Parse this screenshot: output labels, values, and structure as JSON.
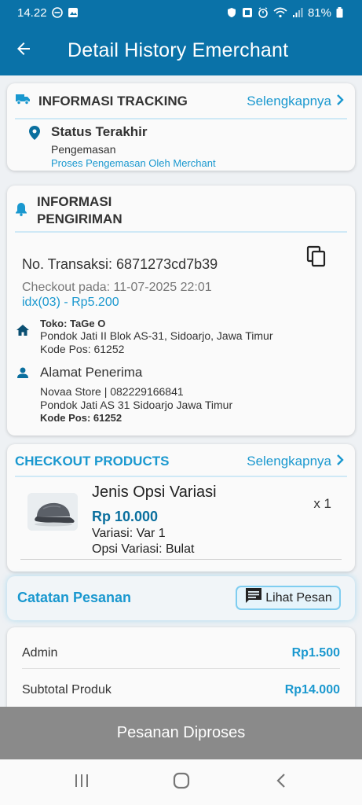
{
  "status_bar": {
    "time": "14.22",
    "battery": "81%"
  },
  "app_bar": {
    "title": "Detail History Emerchant"
  },
  "tracking": {
    "title": "INFORMASI TRACKING",
    "more_label": "Selengkapnya",
    "status_title": "Status Terakhir",
    "status_value": "Pengemasan",
    "status_desc": "Proses Pengemasan Oleh Merchant"
  },
  "shipping": {
    "title_line1": "INFORMASI",
    "title_line2": "PENGIRIMAN",
    "transaction_no": "No. Transaksi: 6871273cd7b39",
    "checkout_at": "Checkout pada: 11-07-2025 22:01",
    "idx_price": "idx(03) - Rp5.200",
    "store_name": "Toko: TaGe O",
    "store_address": "Pondok Jati II Blok AS-31, Sidoarjo, Jawa Timur",
    "store_postal": "Kode Pos: 61252",
    "receiver_title": "Alamat Penerima",
    "receiver_name_phone": "Novaa Store | 082229166841",
    "receiver_address": "Pondok Jati AS 31 Sidoarjo Jawa Timur",
    "receiver_postal": "Kode Pos: 61252"
  },
  "products": {
    "title": "CHECKOUT PRODUCTS",
    "more_label": "Selengkapnya",
    "items": [
      {
        "name": "Jenis Opsi Variasi",
        "price": "Rp 10.000",
        "variant": "Variasi: Var 1",
        "option": "Opsi Variasi: Bulat",
        "qty": "x 1"
      }
    ]
  },
  "notes": {
    "label": "Catatan Pesanan",
    "button_label": "Lihat Pesan"
  },
  "summary": {
    "rows": [
      {
        "label": "Admin",
        "value": "Rp1.500"
      },
      {
        "label": "Subtotal Produk",
        "value": "Rp14.000"
      }
    ]
  },
  "bottom_action": {
    "label": "Pesanan Diproses"
  },
  "colors": {
    "primary": "#0a72a8",
    "accent": "#1a98cf",
    "disabled_button": "#8a8a8a"
  }
}
